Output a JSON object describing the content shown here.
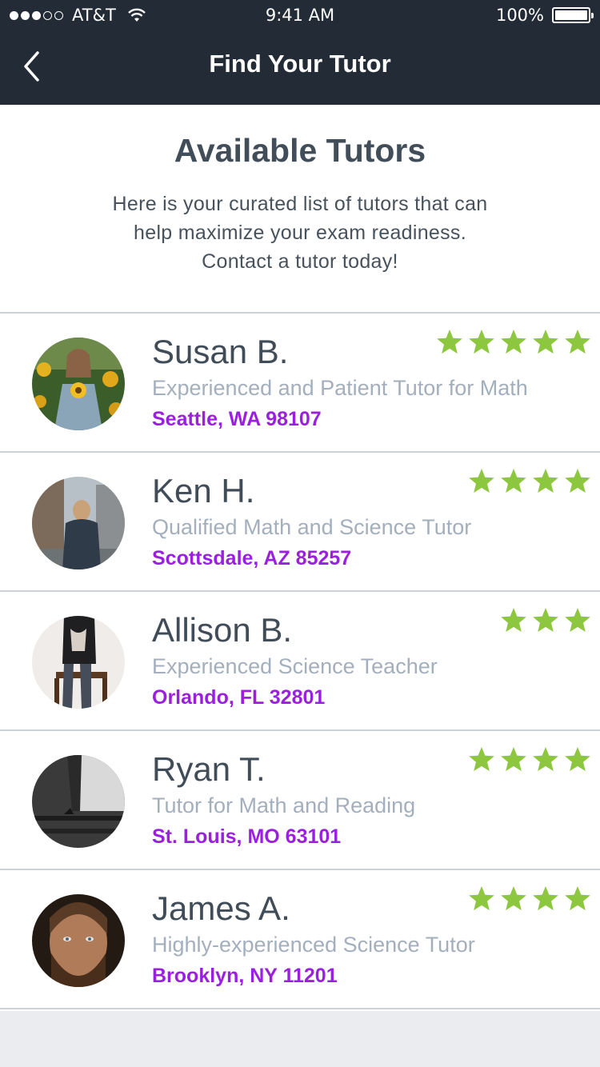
{
  "status_bar": {
    "carrier": "AT&T",
    "signal_bars": 3,
    "signal_total": 5,
    "time": "9:41 AM",
    "battery": "100%"
  },
  "nav": {
    "back_icon": "chevron-left-icon",
    "title": "Find Your Tutor"
  },
  "intro": {
    "heading": "Available Tutors",
    "lines": [
      "Here is your curated list of tutors that can",
      "help maximize your exam readiness.",
      "Contact a tutor today!"
    ]
  },
  "colors": {
    "header_bg": "#222b36",
    "star": "#8dc63f",
    "location": "#9b1fe0",
    "tagline": "#a4afbd",
    "name": "#404c58"
  },
  "tutors": [
    {
      "name": "Susan B.",
      "tagline": "Experienced and Patient Tutor for Math",
      "location": "Seattle, WA 98107",
      "rating": 5
    },
    {
      "name": "Ken H.",
      "tagline": "Qualified Math and Science Tutor",
      "location": "Scottsdale, AZ 85257",
      "rating": 4
    },
    {
      "name": "Allison B.",
      "tagline": "Experienced Science Teacher",
      "location": "Orlando, FL 32801",
      "rating": 3
    },
    {
      "name": "Ryan T.",
      "tagline": "Tutor for Math and Reading",
      "location": "St. Louis, MO 63101",
      "rating": 4
    },
    {
      "name": "James A.",
      "tagline": "Highly-experienced Science Tutor",
      "location": "Brooklyn, NY 11201",
      "rating": 4
    }
  ]
}
